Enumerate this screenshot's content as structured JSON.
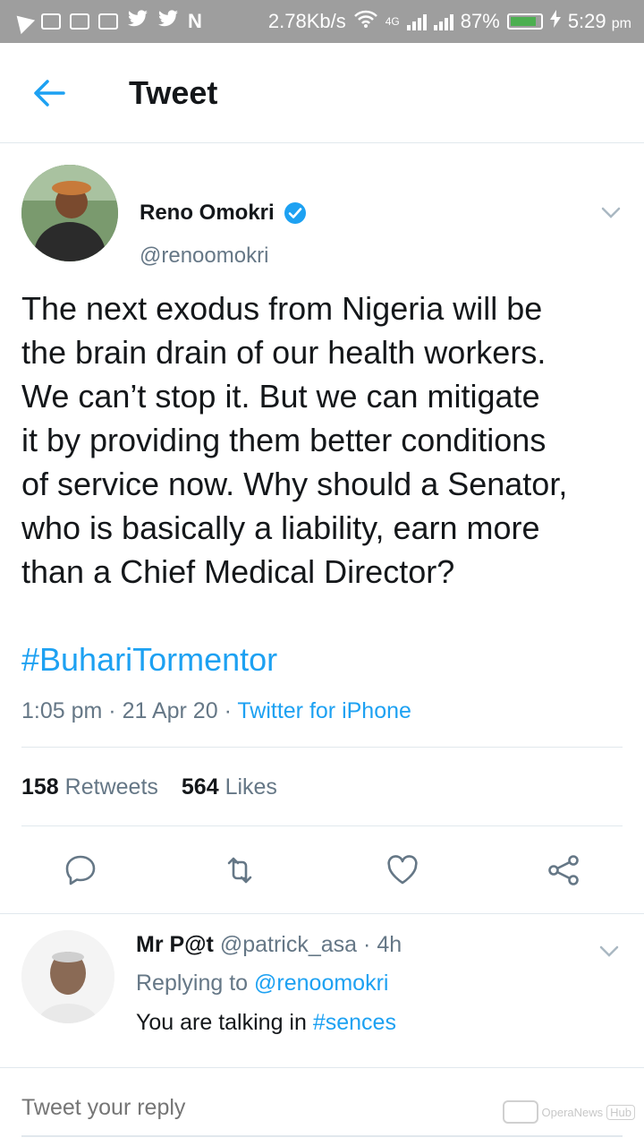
{
  "status_bar": {
    "speed": "2.78Kb/s",
    "battery": "87%",
    "time": "5:29",
    "ampm": "pm",
    "network_label": "4G"
  },
  "header": {
    "title": "Tweet"
  },
  "tweet": {
    "author_name": "Reno Omokri",
    "author_handle": "@renoomokri",
    "text": "The next exodus from Nigeria will be\nthe brain drain of our health workers.\nWe can’t stop it. But we can mitigate\nit by providing them better conditions\nof service now. Why should a Senator,\nwho is basically a liability, earn more\nthan a Chief Medical Director?",
    "hashtag": "#BuhariTormentor",
    "time": "1:05 pm",
    "date": "21 Apr 20",
    "source": "Twitter for iPhone",
    "retweet_count": "158",
    "retweet_label": "Retweets",
    "like_count": "564",
    "like_label": "Likes"
  },
  "reply": {
    "name": "Mr P@t",
    "handle": "@patrick_asa",
    "age": "4h",
    "replying_prefix": "Replying to",
    "replying_to": "@renoomokri",
    "text_prefix": "You are talking in",
    "text_link": "#sences"
  },
  "composer": {
    "placeholder": "Tweet your reply"
  },
  "watermark": {
    "text": "OperaNews",
    "hub": "Hub"
  },
  "colors": {
    "accent": "#1da1f2",
    "muted": "#657786",
    "text": "#14171a",
    "status_bar": "#9e9e9e"
  }
}
